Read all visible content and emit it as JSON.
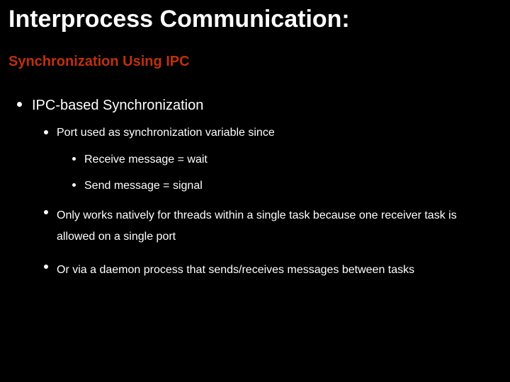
{
  "title": "Interprocess Communication:",
  "subtitle": "Synchronization Using IPC",
  "bullets": [
    {
      "text": "IPC-based Synchronization",
      "children": [
        {
          "text": "Port used as synchronization variable since",
          "children": [
            {
              "text": "Receive message = wait"
            },
            {
              "text": "Send message = signal"
            }
          ]
        },
        {
          "text": "Only works natively for threads within a single task because one receiver task is allowed on a single port"
        },
        {
          "text": "Or via a daemon process that sends/receives messages between tasks"
        }
      ]
    }
  ]
}
